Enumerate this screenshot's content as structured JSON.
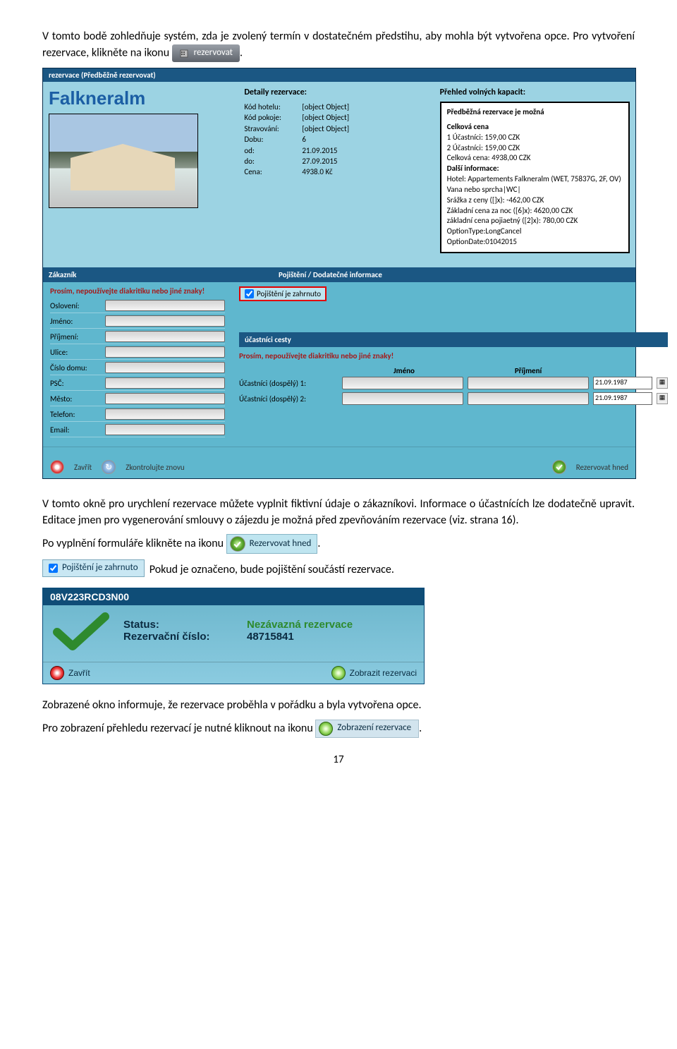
{
  "doc": {
    "intro1": "V tomto bodě zohledňuje systém, zda je zvolený termín v dostatečném předstihu, aby mohla být vytvořena opce. Pro vytvoření rezervace, klikněte na ikonu",
    "reserve_btn": "rezervovat",
    "mid1_a": "V tomto okně pro urychlení rezervace můžete vyplnit fiktivní údaje o zákazníkovi. Informace o účastnících lze dodatečně upravit. Editace jmen pro vygenerování smlouvy o zájezdu je možná před zpevňováním rezervace (viz. strana 16).",
    "mid2_a": "Po vyplnění formuláře klikněte na ikonu",
    "reserve_now": "Rezervovat hned",
    "insur_chip": "Pojištění je zahrnuto",
    "insur_text": "Pokud je označeno, bude pojištění součástí rezervace.",
    "out_a": "Zobrazené okno informuje, že rezervace proběhla v pořádku a byla vytvořena opce.",
    "out_b": "Pro zobrazení přehledu rezervací je nutné kliknout na ikonu",
    "zobr_btn": "Zobrazení rezervace",
    "pagenum": "17"
  },
  "shot1": {
    "tab": "rezervace (Předběžně rezervovat)",
    "title": "Falkneralm",
    "details_hdr": "Detaily rezervace:",
    "details": [
      [
        "Kód hotelu:",
        "[object Object]"
      ],
      [
        "Kód pokoje:",
        "[object Object]"
      ],
      [
        "Stravování:",
        "[object Object]"
      ],
      [
        "Dobu:",
        "6"
      ],
      [
        "od:",
        "21.09.2015"
      ],
      [
        "do:",
        "27.09.2015"
      ],
      [
        "Cena:",
        "4938.0 Kč"
      ]
    ],
    "cap_hdr": "Přehled volných kapacit:",
    "cap_box": {
      "line0": "Předběžná rezervace je možná",
      "head1": "Celková cena",
      "lines": [
        "1 Účastníci: 159,00 CZK",
        "2 Účastníci: 159,00 CZK",
        "Celková cena: 4938,00 CZK"
      ],
      "head2": "Další informace:",
      "lines2": [
        "Hotel: Appartements Falkneralm (WET, 75837G, 2F, OV)",
        "Vana nebo sprcha|WC|",
        "Srážka z ceny ([]x): -462,00 CZK",
        "Základní cena za noc ([6]x): 4620,00 CZK",
        "základní cena pojiaetný ([2]x): 780,00 CZK",
        "OptionType:LongCancel",
        "OptionDate:01042015"
      ]
    },
    "bar_zak": "Zákazník",
    "bar_poj": "Pojištění / Dodatečné informace",
    "warn": "Prosím, nepoužívejte diakritiku nebo jiné znaky!",
    "fields": [
      "Oslovení:",
      "Jméno:",
      "Příjmení:",
      "Ulice:",
      "Číslo domu:",
      "PSČ:",
      "Město:",
      "Telefon:",
      "Email:"
    ],
    "poj_check": "Pojištění je zahrnuto",
    "bar_uc": "účastníci cesty",
    "trav_hdr": [
      "Jméno",
      "Příjmení"
    ],
    "trav_rows": [
      {
        "label": "Účastníci (dospělý) 1:",
        "date": "21.09.1987"
      },
      {
        "label": "Účastníci (dospělý) 2:",
        "date": "21.09.1987"
      }
    ],
    "bot_close": "Zavřít",
    "bot_check": "Zkontrolujte znovu",
    "bot_reserve": "Rezervovat hned"
  },
  "shot2": {
    "code": "08V223RCD3N00",
    "status_k": "Status:",
    "status_v": "Nezávazná rezervace",
    "num_k": "Rezervační číslo:",
    "num_v": "48715841",
    "close": "Zavřít",
    "show": "Zobrazit rezervaci"
  }
}
